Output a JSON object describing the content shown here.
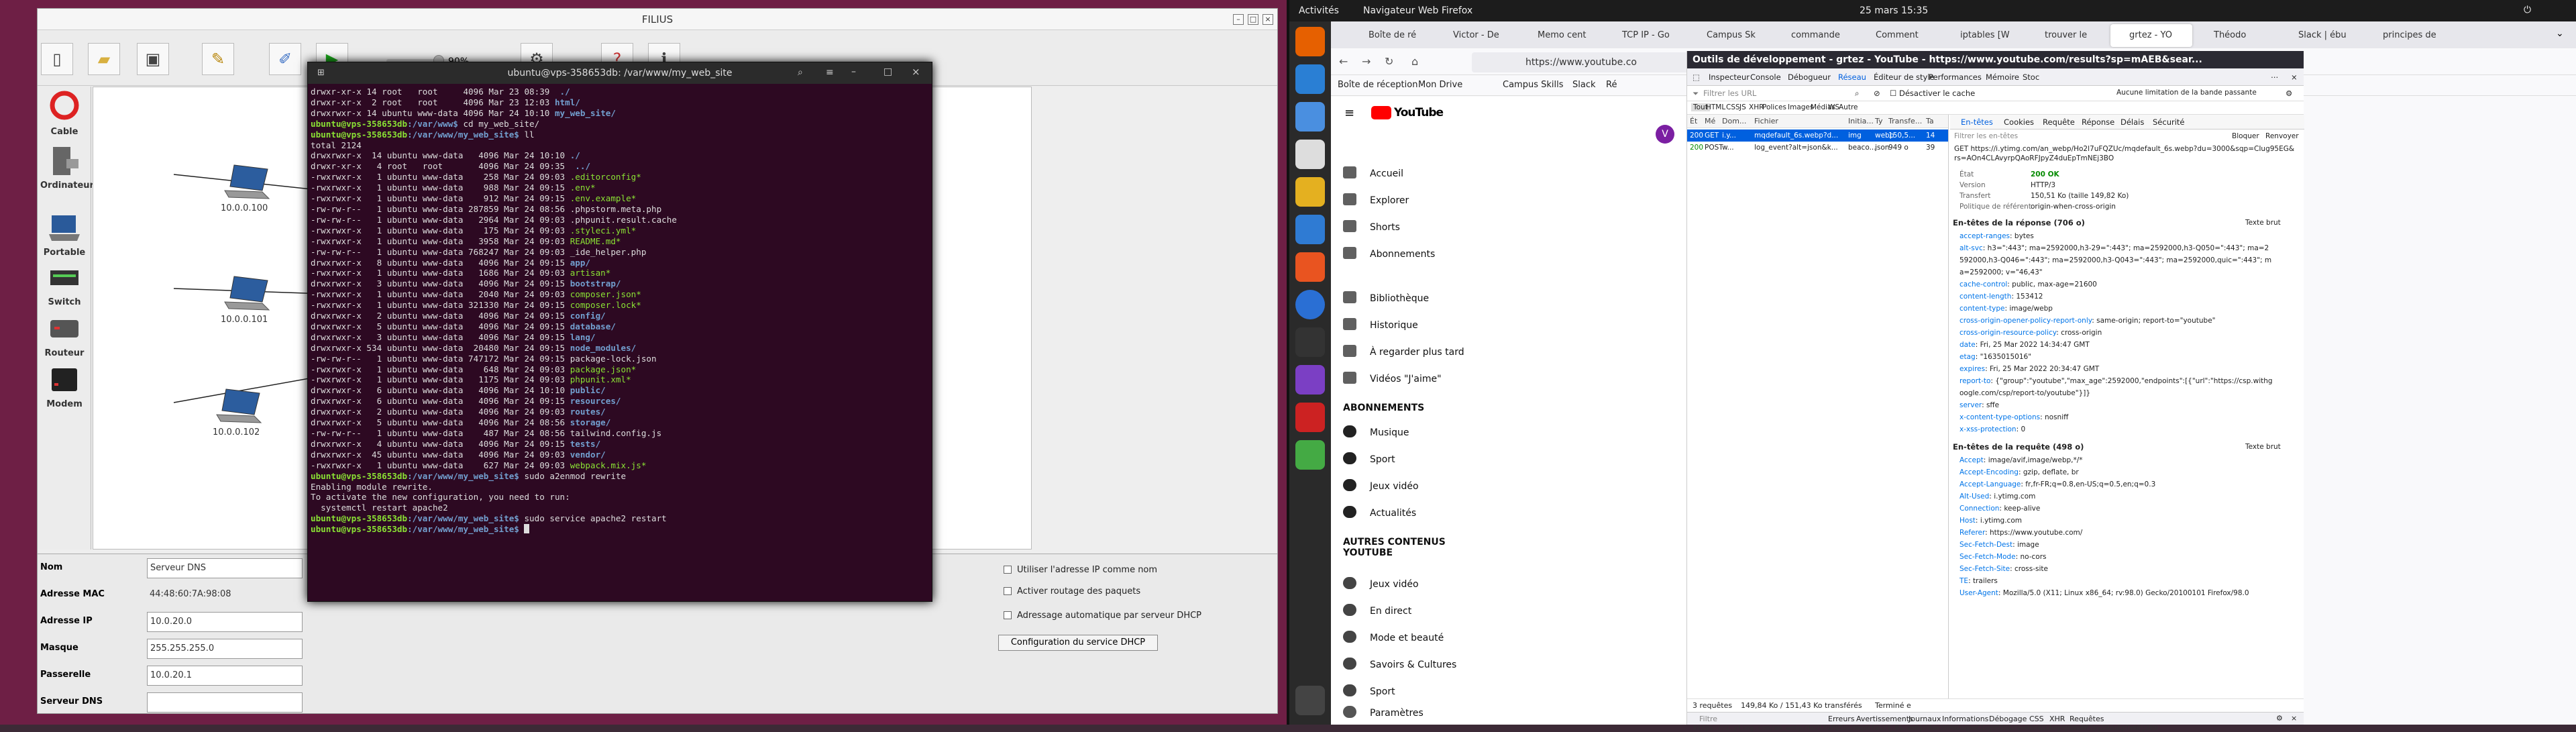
{
  "filius": {
    "title": "FILIUS",
    "zoom": "90%",
    "palette": [
      "Cable",
      "Ordinateur",
      "Portable",
      "Switch",
      "Routeur",
      "Modem"
    ],
    "nodes": [
      "10.0.0.100",
      "10.0.0.101",
      "10.0.0.102"
    ],
    "props": {
      "labels": [
        "Nom",
        "Adresse MAC",
        "Adresse IP",
        "Masque",
        "Passerelle",
        "Serveur DNS"
      ],
      "values": [
        "Serveur DNS",
        "44:48:60:7A:98:08",
        "10.0.20.0",
        "255.255.255.0",
        "10.0.20.1",
        ""
      ]
    },
    "checks": [
      "Utiliser l'adresse IP comme nom",
      "Activer routage des paquets",
      "Adressage automatique par serveur DHCP"
    ],
    "dhcp_button": "Configuration du service DHCP"
  },
  "terminal": {
    "title": "ubuntu@vps-358653db: /var/www/my_web_site",
    "lines": [
      [
        "drwxr-xr-x 14 root   root     4096 Mar 23 08:39  ",
        "",
        "./"
      ],
      [
        "drwxr-xr-x  2 root   root     4096 Mar 23 12:03 ",
        "",
        "html/"
      ],
      [
        "drwxrwxr-x 14 ubuntu www-data 4096 Mar 24 10:10 ",
        "",
        "my_web_site/"
      ],
      [
        "ubuntu@vps-358653db",
        ":/var/www$ ",
        "cd my_web_site/"
      ],
      [
        "ubuntu@vps-358653db",
        ":/var/www/my_web_site$ ",
        "ll"
      ],
      [
        "total 2124",
        "",
        ""
      ],
      [
        "drwxrwxr-x  14 ubuntu www-data   4096 Mar 24 10:10 ",
        "",
        "./"
      ],
      [
        "drwxr-xr-x   4 root   root       4096 Mar 24 09:35  ",
        "",
        "../"
      ],
      [
        "-rwxrwxr-x   1 ubuntu www-data    258 Mar 24 09:03 ",
        "",
        ".editorconfig*"
      ],
      [
        "-rwxrwxr-x   1 ubuntu www-data    988 Mar 24 09:15 ",
        "",
        ".env*"
      ],
      [
        "-rwxrwxr-x   1 ubuntu www-data    912 Mar 24 09:15 ",
        "",
        ".env.example*"
      ],
      [
        "-rw-rw-r--   1 ubuntu www-data 287859 Mar 24 08:56 ",
        "",
        ".phpstorm.meta.php"
      ],
      [
        "-rw-rw-r--   1 ubuntu www-data   2964 Mar 24 09:03 ",
        "",
        ".phpunit.result.cache"
      ],
      [
        "-rwxrwxr-x   1 ubuntu www-data    175 Mar 24 09:03 ",
        "",
        ".styleci.yml*"
      ],
      [
        "-rwxrwxr-x   1 ubuntu www-data   3958 Mar 24 09:03 ",
        "",
        "README.md*"
      ],
      [
        "-rw-rw-r--   1 ubuntu www-data 768247 Mar 24 09:03 ",
        "",
        "_ide_helper.php"
      ],
      [
        "drwxrwxr-x   8 ubuntu www-data   4096 Mar 24 09:15 ",
        "",
        "app/"
      ],
      [
        "-rwxrwxr-x   1 ubuntu www-data   1686 Mar 24 09:03 ",
        "",
        "artisan*"
      ],
      [
        "drwxrwxr-x   3 ubuntu www-data   4096 Mar 24 09:15 ",
        "",
        "bootstrap/"
      ],
      [
        "-rwxrwxr-x   1 ubuntu www-data   2040 Mar 24 09:03 ",
        "",
        "composer.json*"
      ],
      [
        "-rwxrwxr-x   1 ubuntu www-data 321330 Mar 24 09:15 ",
        "",
        "composer.lock*"
      ],
      [
        "drwxrwxr-x   2 ubuntu www-data   4096 Mar 24 09:15 ",
        "",
        "config/"
      ],
      [
        "drwxrwxr-x   5 ubuntu www-data   4096 Mar 24 09:15 ",
        "",
        "database/"
      ],
      [
        "drwxrwxr-x   3 ubuntu www-data   4096 Mar 24 09:15 ",
        "",
        "lang/"
      ],
      [
        "drwxrwxr-x 534 ubuntu www-data  20480 Mar 24 09:15 ",
        "",
        "node_modules/"
      ],
      [
        "-rw-rw-r--   1 ubuntu www-data 747172 Mar 24 09:15 ",
        "",
        "package-lock.json"
      ],
      [
        "-rwxrwxr-x   1 ubuntu www-data    648 Mar 24 09:03 ",
        "",
        "package.json*"
      ],
      [
        "-rwxrwxr-x   1 ubuntu www-data   1175 Mar 24 09:03 ",
        "",
        "phpunit.xml*"
      ],
      [
        "drwxrwxr-x   6 ubuntu www-data   4096 Mar 24 10:10 ",
        "",
        "public/"
      ],
      [
        "drwxrwxr-x   6 ubuntu www-data   4096 Mar 24 09:15 ",
        "",
        "resources/"
      ],
      [
        "drwxrwxr-x   2 ubuntu www-data   4096 Mar 24 09:03 ",
        "",
        "routes/"
      ],
      [
        "drwxrwxr-x   5 ubuntu www-data   4096 Mar 24 08:56 ",
        "",
        "storage/"
      ],
      [
        "-rw-rw-r--   1 ubuntu www-data    487 Mar 24 08:56 ",
        "",
        "tailwind.config.js"
      ],
      [
        "drwxrwxr-x   4 ubuntu www-data   4096 Mar 24 09:15 ",
        "",
        "tests/"
      ],
      [
        "drwxrwxr-x  45 ubuntu www-data   4096 Mar 24 09:03 ",
        "",
        "vendor/"
      ],
      [
        "-rwxrwxr-x   1 ubuntu www-data    627 Mar 24 09:03 ",
        "",
        "webpack.mix.js*"
      ],
      [
        "ubuntu@vps-358653db",
        ":/var/www/my_web_site$ ",
        "sudo a2enmod rewrite"
      ],
      [
        "Enabling module rewrite.",
        "",
        ""
      ],
      [
        "To activate the new configuration, you need to run:",
        "",
        ""
      ],
      [
        "  systemctl restart apache2",
        "",
        ""
      ],
      [
        "ubuntu@vps-358653db",
        ":/var/www/my_web_site$ ",
        "sudo service apache2 restart"
      ],
      [
        "ubuntu@vps-358653db",
        ":/var/www/my_web_site$ ",
        ""
      ]
    ]
  },
  "topbar": {
    "activities": "Activités",
    "app": "Navigateur Web Firefox",
    "clock": "25 mars  15:35"
  },
  "firefox": {
    "tabs": [
      "Boîte de ré",
      "Victor - De",
      "Memo cent",
      "TCP IP - Go",
      "Campus Sk",
      "commande",
      "Comment",
      "iptables [W",
      "trouver le",
      "grtez - YO",
      "Théodo",
      "Slack | ébu",
      "principes de"
    ],
    "url": "https://www.youtube.co",
    "bookmarks": [
      "Boîte de réception",
      "Mon Drive",
      "Campus Skills",
      "Slack",
      "Ré"
    ],
    "yt_logo": "YouTube",
    "yt_nav": [
      "Accueil",
      "Explorer",
      "Shorts",
      "Abonnements",
      "Bibliothèque",
      "Historique",
      "À regarder plus tard",
      "Vidéos \"J'aime\""
    ],
    "yt_subs_head": "ABONNEMENTS",
    "yt_subs": [
      "Musique",
      "Sport",
      "Jeux vidéo",
      "Actualités"
    ],
    "yt_more_head": "AUTRES CONTENUS YOUTUBE",
    "yt_more": [
      "Jeux vidéo",
      "En direct",
      "Mode et beauté",
      "Savoirs & Cultures",
      "Sport"
    ],
    "yt_settings": "Paramètres",
    "avatar": "V"
  },
  "devtools": {
    "title": "Outils de développement - grtez - YouTube - https://www.youtube.com/results?sp=mAEB&sear...",
    "tools": [
      "Inspecteur",
      "Console",
      "Débogueur",
      "Réseau",
      "Éditeur de style",
      "Performances",
      "Mémoire",
      "Stoc"
    ],
    "filter_placeholder": "Filtrer les URL",
    "cache": "Désactiver le cache",
    "throttle": "Aucune limitation de la bande passante",
    "types": [
      "Tout",
      "HTML",
      "CSS",
      "JS",
      "XHR",
      "Polices",
      "Images",
      "Médias",
      "WS",
      "Autre"
    ],
    "req_cols": [
      "Ét",
      "Mé",
      "Dom...",
      "Fichier",
      "Initia...",
      "Ty",
      "Transfe...",
      "Ta"
    ],
    "requests": [
      [
        "200",
        "GET",
        "i.y...",
        "mqdefault_6s.webp?d...",
        "img",
        "webp",
        "150,5...",
        "14"
      ],
      [
        "200",
        "POST",
        "w...",
        "log_event?alt=json&k...",
        "beaco...",
        "json",
        "949 o",
        "39"
      ]
    ],
    "det_tabs": [
      "En-têtes",
      "Cookies",
      "Requête",
      "Réponse",
      "Délais",
      "Sécurité"
    ],
    "det_filter": "Filtrer les en-têtes",
    "det_actions": [
      "Bloquer",
      "Renvoyer"
    ],
    "get_url": "GET https://i.ytimg.com/an_webp/Ho2l7uFQZUc/mqdefault_6s.webp?du=3000&sqp=CIug95EG&rs=AOn4CLAvyrpQAoRFJpyZ4duEpTmNEj3BO",
    "summary": [
      [
        "État",
        "200 OK"
      ],
      [
        "Version",
        "HTTP/3"
      ],
      [
        "Transfert",
        "150,51 Ko (taille 149,82 Ko)"
      ],
      [
        "Politique de référent",
        "origin-when-cross-origin"
      ]
    ],
    "resp_head": "En-têtes de la réponse (706 o)",
    "raw": "Texte brut",
    "resp_headers": [
      [
        "accept-ranges",
        "bytes"
      ],
      [
        "alt-svc",
        "h3=\":443\"; ma=2592000,h3-29=\":443\"; ma=2592000,h3-Q050=\":443\"; ma=2"
      ],
      [
        "",
        "592000,h3-Q046=\":443\"; ma=2592000,h3-Q043=\":443\"; ma=2592000,quic=\":443\"; m"
      ],
      [
        "",
        "a=2592000; v=\"46,43\""
      ],
      [
        "cache-control",
        "public, max-age=21600"
      ],
      [
        "content-length",
        "153412"
      ],
      [
        "content-type",
        "image/webp"
      ],
      [
        "cross-origin-opener-policy-report-only",
        "same-origin; report-to=\"youtube\""
      ],
      [
        "cross-origin-resource-policy",
        "cross-origin"
      ],
      [
        "date",
        "Fri, 25 Mar 2022 14:34:47 GMT"
      ],
      [
        "etag",
        "\"1635015016\""
      ],
      [
        "expires",
        "Fri, 25 Mar 2022 20:34:47 GMT"
      ],
      [
        "report-to",
        "{\"group\":\"youtube\",\"max_age\":2592000,\"endpoints\":[{\"url\":\"https://csp.withg"
      ],
      [
        "",
        "oogle.com/csp/report-to/youtube\"}]}"
      ],
      [
        "server",
        "sffe"
      ],
      [
        "x-content-type-options",
        "nosniff"
      ],
      [
        "x-xss-protection",
        "0"
      ]
    ],
    "req_head": "En-têtes de la requête (498 o)",
    "req_headers": [
      [
        "Accept",
        "image/avif,image/webp,*/*"
      ],
      [
        "Accept-Encoding",
        "gzip, deflate, br"
      ],
      [
        "Accept-Language",
        "fr,fr-FR;q=0.8,en-US;q=0.5,en;q=0.3"
      ],
      [
        "Alt-Used",
        "i.ytimg.com"
      ],
      [
        "Connection",
        "keep-alive"
      ],
      [
        "Host",
        "i.ytimg.com"
      ],
      [
        "Referer",
        "https://www.youtube.com/"
      ],
      [
        "Sec-Fetch-Dest",
        "image"
      ],
      [
        "Sec-Fetch-Mode",
        "no-cors"
      ],
      [
        "Sec-Fetch-Site",
        "cross-site"
      ],
      [
        "TE",
        "trailers"
      ],
      [
        "User-Agent",
        "Mozilla/5.0 (X11; Linux x86_64; rv:98.0) Gecko/20100101 Firefox/98.0"
      ]
    ],
    "status": [
      "3 requêtes",
      "149,84 Ko / 151,43 Ko transférés",
      "Terminé e"
    ],
    "console_tabs": [
      "Erreurs",
      "Avertissements",
      "Journaux",
      "Informations",
      "Débogage",
      "CSS",
      "XHR",
      "Requêtes"
    ],
    "console_filter": "Filtre",
    "console_out": "https://i.ytimg.com/an_webp/Ho2l7uFQZUc/mqdefault_6s.webp?du=3000&sqp=CIug95EG&rs=AOn4CLAvyrpQAoRFJpyZ4duEpTmNEj3BO"
  },
  "colors": {
    "accent": "#0060df",
    "term_bg": "#2d0922",
    "prompt": "#8ae234",
    "dir": "#729fcf"
  }
}
